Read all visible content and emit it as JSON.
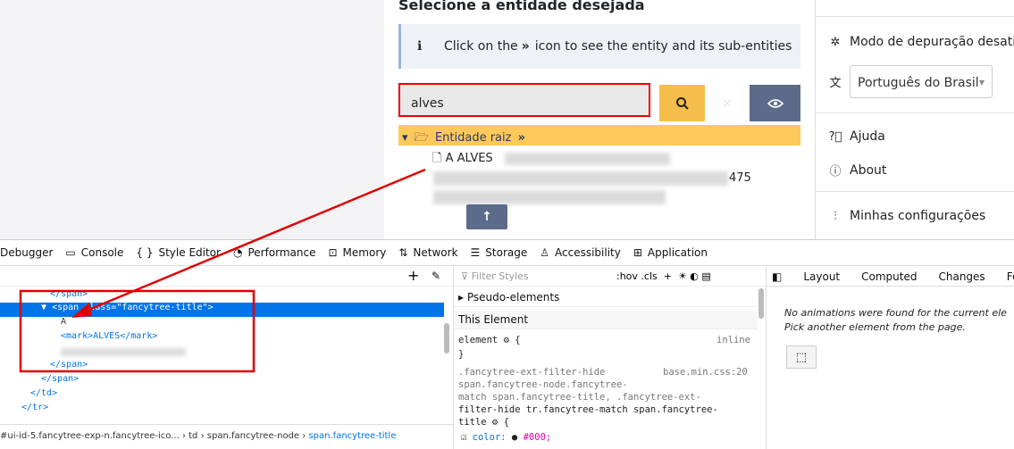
{
  "panel": {
    "title": "Selecione a entidade desejada",
    "info_text_before": "Click on the",
    "info_text_after": "icon to see the entity and its sub-entities",
    "search_value": "alves",
    "clear_label": "×",
    "root_label": "Entidade raiz",
    "node1_text": "A ALVES",
    "node2_suffix": "475",
    "up_label": "↑"
  },
  "sidebar": {
    "debug_label": "Modo de depuração desativ",
    "language_value": "Português do Brasil",
    "help_label": "Ajuda",
    "about_label": "About",
    "settings_label": "Minhas configurações"
  },
  "devtools": {
    "tabs": [
      "Debugger",
      "Console",
      "Style Editor",
      "Performance",
      "Memory",
      "Network",
      "Storage",
      "Accessibility",
      "Application"
    ],
    "tab_icons": [
      "",
      "▭",
      "{ }",
      "◔",
      "⊡",
      "⇅",
      "☰",
      "♙",
      "⊞"
    ],
    "tree": {
      "line1": "</span>",
      "sel_tag_open": "<span ",
      "sel_attr": "class=",
      "sel_val": "\"fancytree-title\"",
      "sel_tag_close": ">",
      "line_a": "A",
      "line_mark": "<mark>ALVES</mark>",
      "line_close_span": "</span>",
      "line_close_span2": "</span>",
      "line_close_td": "</td>",
      "line_close_tr": "</tr>"
    },
    "breadcrumbs": [
      "#ui-id-5.fancytree-exp-n.fancytree-ico...",
      "td",
      "span.fancytree-node",
      "span.fancytree-title"
    ],
    "rules": {
      "filter_placeholder": "Filter Styles",
      "hov_cls": ":hov .cls",
      "pseudo": "Pseudo-elements",
      "this_element": "This Element",
      "element_rule": "element ⚙ {",
      "inline": "inline",
      "close_brace": "}",
      "sel1": ".fancytree-ext-filter-hide",
      "sel2": "span.fancytree-node.fancytree-",
      "sel3": "match span.fancytree-title, .fancytree-ext-",
      "sel4": "filter-hide tr.fancytree-match span.fancytree-",
      "sel5": "title ⚙ {",
      "source": "base.min.css:20",
      "color_prop": "color:",
      "color_val": "#000;"
    },
    "anim_tabs": [
      "Layout",
      "Computed",
      "Changes",
      "Fonts"
    ],
    "anim_msg1": "No animations were found for the current ele",
    "anim_msg2": "Pick another element from the page."
  },
  "colors": {
    "accent": "#f5bd4c",
    "root_row": "#fdc95b",
    "eye_btn": "#5c6b8a",
    "selection": "#0074e8",
    "annotation": "#e00000"
  }
}
